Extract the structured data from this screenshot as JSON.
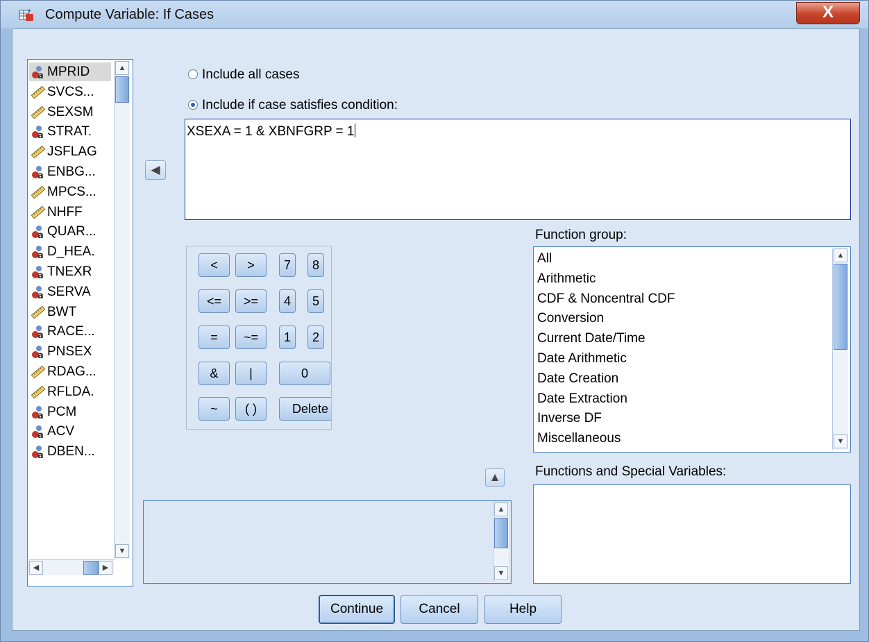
{
  "window": {
    "title": "Compute Variable: If Cases",
    "close_label": "X"
  },
  "variables": [
    {
      "name": "MPRID",
      "type": "nominal",
      "selected": true
    },
    {
      "name": "SVCS...",
      "type": "scale"
    },
    {
      "name": "SEXSM",
      "type": "scale"
    },
    {
      "name": "STRAT.",
      "type": "nominal"
    },
    {
      "name": "JSFLAG",
      "type": "scale"
    },
    {
      "name": "ENBG...",
      "type": "nominal"
    },
    {
      "name": "MPCS...",
      "type": "scale"
    },
    {
      "name": "NHFF",
      "type": "scale"
    },
    {
      "name": "QUAR...",
      "type": "nominal"
    },
    {
      "name": "D_HEA.",
      "type": "nominal"
    },
    {
      "name": "TNEXR",
      "type": "nominal"
    },
    {
      "name": "SERVA",
      "type": "nominal"
    },
    {
      "name": "BWT",
      "type": "scale"
    },
    {
      "name": "RACE...",
      "type": "nominal"
    },
    {
      "name": "PNSEX",
      "type": "nominal"
    },
    {
      "name": "RDAG...",
      "type": "scale"
    },
    {
      "name": "RFLDA.",
      "type": "scale"
    },
    {
      "name": "PCM",
      "type": "nominal"
    },
    {
      "name": "ACV",
      "type": "nominal"
    },
    {
      "name": "DBEN...",
      "type": "nominal"
    }
  ],
  "radio_all_cases": "Include all cases",
  "radio_condition": "Include if case satisfies condition:",
  "condition_text": "XSEXA = 1 & XBNFGRP = 1",
  "keypad": [
    {
      "label": "<"
    },
    {
      "label": ">"
    },
    {
      "label": "7"
    },
    {
      "label": "8"
    },
    {
      "label": "<="
    },
    {
      "label": ">="
    },
    {
      "label": "4"
    },
    {
      "label": "5"
    },
    {
      "label": "="
    },
    {
      "label": "~="
    },
    {
      "label": "1"
    },
    {
      "label": "2"
    },
    {
      "label": "&"
    },
    {
      "label": "|"
    },
    {
      "label": "0"
    },
    {
      "label": "~"
    },
    {
      "label": "( )"
    },
    {
      "label": "Delete"
    }
  ],
  "function_group_label": "Function group:",
  "function_groups": [
    "All",
    "Arithmetic",
    "CDF & Noncentral CDF",
    "Conversion",
    "Current Date/Time",
    "Date Arithmetic",
    "Date Creation",
    "Date Extraction",
    "Inverse DF",
    "Miscellaneous"
  ],
  "functions_label": "Functions and Special Variables:",
  "buttons": {
    "continue": "Continue",
    "cancel": "Cancel",
    "help": "Help"
  },
  "icons": {
    "nominal": "nominal-variable-icon",
    "scale": "scale-ruler-icon",
    "accent": "#4a7fbe",
    "close_red": "#c7442b"
  }
}
